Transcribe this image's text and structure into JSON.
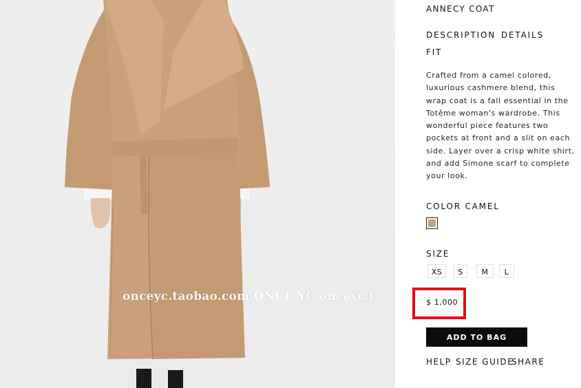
{
  "product": {
    "title": "ANNECY COAT",
    "image_alt_icon": "product-photo"
  },
  "watermark": "onceyc.taobao.com ONCE YC onceyc.t",
  "tabs": {
    "description": "DESCRIPTION",
    "details": "DETAILS",
    "fit": "FIT"
  },
  "description": "Crafted from a camel colored, luxurious cashmere blend, this wrap coat is a fall essential in the Totême woman's wardrobe. This wonderful piece features two pockets at front and a slit on each side. Layer over a crisp white shirt, and add Simone scarf to complete your look.",
  "color": {
    "label": "COLOR CAMEL",
    "swatch_hex": "#c4a380"
  },
  "size": {
    "label": "SIZE",
    "options": [
      "XS",
      "S",
      "M",
      "L"
    ]
  },
  "price": "$ 1,000",
  "highlight_color": "#e50d14",
  "actions": {
    "add_to_bag": "ADD TO BAG"
  },
  "links": {
    "help": "HELP",
    "size_guide": "SIZE GUIDE",
    "share": "SHARE"
  }
}
